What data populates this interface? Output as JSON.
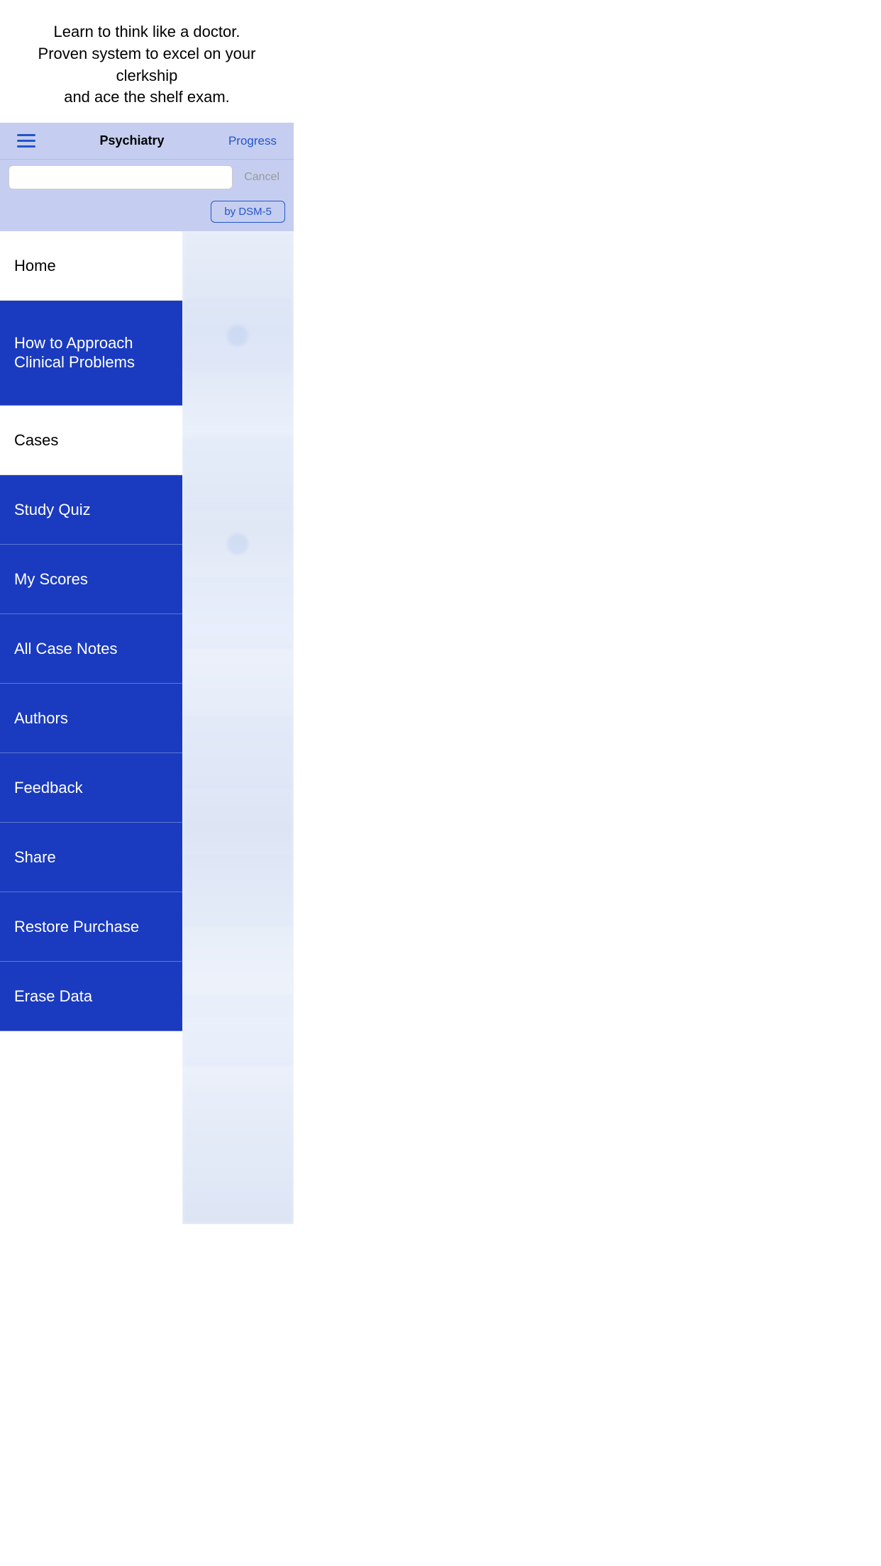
{
  "hero": {
    "line1": "Learn to think like a doctor.",
    "line2": "Proven system to excel on your clerkship",
    "line3": "and ace the shelf exam."
  },
  "navbar": {
    "title": "Psychiatry",
    "progress_label": "Progress"
  },
  "search": {
    "placeholder": "",
    "cancel_label": "Cancel"
  },
  "dsm_toggle": {
    "label": "by DSM-5"
  },
  "menu": {
    "items": [
      {
        "id": "home",
        "label": "Home",
        "style": "white"
      },
      {
        "id": "how-to-approach",
        "label": "How to Approach Clinical Problems",
        "style": "blue",
        "multiline": true
      },
      {
        "id": "cases",
        "label": "Cases",
        "style": "white"
      },
      {
        "id": "study-quiz",
        "label": "Study Quiz",
        "style": "blue"
      },
      {
        "id": "my-scores",
        "label": "My Scores",
        "style": "blue"
      },
      {
        "id": "all-case-notes",
        "label": "All Case Notes",
        "style": "blue"
      },
      {
        "id": "authors",
        "label": "Authors",
        "style": "blue"
      },
      {
        "id": "feedback",
        "label": "Feedback",
        "style": "blue"
      },
      {
        "id": "share",
        "label": "Share",
        "style": "blue"
      },
      {
        "id": "restore-purchase",
        "label": "Restore Purchase",
        "style": "blue"
      },
      {
        "id": "erase-data",
        "label": "Erase Data",
        "style": "blue"
      }
    ]
  },
  "colors": {
    "blue_menu": "#1a3bbf",
    "navbar_bg": "#c5cef0",
    "blue_accent": "#2255cc"
  }
}
